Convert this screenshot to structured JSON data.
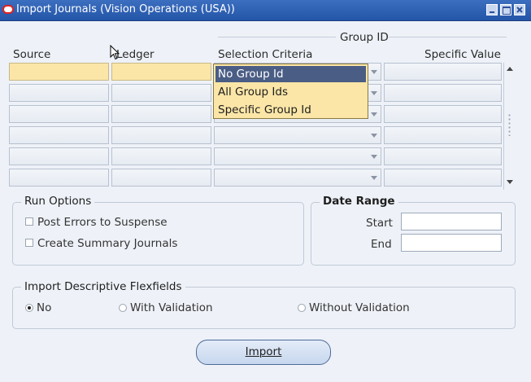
{
  "window": {
    "title": "Import Journals (Vision Operations (USA))",
    "controls": [
      "minimize-icon",
      "maximize-icon",
      "close-icon"
    ]
  },
  "grid": {
    "group_header": "Group ID",
    "columns": [
      "Source",
      "Ledger",
      "Selection Criteria",
      "Specific Value"
    ],
    "row_count": 6
  },
  "dropdown": {
    "options": [
      "No Group Id",
      "All Group Ids",
      "Specific Group Id"
    ],
    "selected": "No Group Id"
  },
  "run_options": {
    "label": "Run Options",
    "post_errors": {
      "label": "Post Errors to Suspense",
      "checked": false
    },
    "create_summary": {
      "label": "Create Summary Journals",
      "checked": false
    }
  },
  "date_range": {
    "label": "Date Range",
    "start_label": "Start",
    "end_label": "End",
    "start_value": "",
    "end_value": ""
  },
  "flexfields": {
    "label": "Import Descriptive Flexfields",
    "options": [
      "No",
      "With Validation",
      "Without Validation"
    ],
    "selected": "No"
  },
  "import_button": "Import",
  "colors": {
    "titlebar": "#2f62b4",
    "background": "#eef2f8",
    "selected_row": "#fbe6a7",
    "dropdown_highlight": "#4a5d85"
  }
}
